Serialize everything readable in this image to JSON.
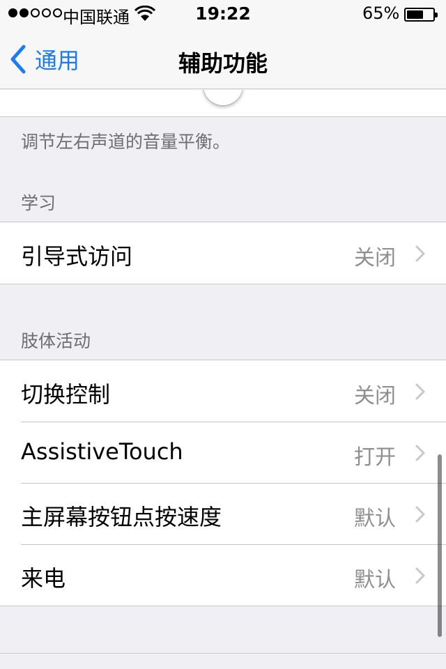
{
  "status_bar": {
    "signal_total": 5,
    "signal_active": 2,
    "carrier": "中国联通",
    "time": "19:22",
    "battery_text": "65%",
    "battery_level": 0.65
  },
  "nav": {
    "back_label": "通用",
    "title": "辅助功能"
  },
  "audio": {
    "footnote": "调节左右声道的音量平衡。"
  },
  "sections": [
    {
      "header": "学习",
      "rows": [
        {
          "label": "引导式访问",
          "value": "关闭"
        }
      ]
    },
    {
      "header": "肢体活动",
      "rows": [
        {
          "label": "切换控制",
          "value": "关闭"
        },
        {
          "label": "AssistiveTouch",
          "value": "打开"
        },
        {
          "label": "主屏幕按钮点按速度",
          "value": "默认"
        },
        {
          "label": "来电",
          "value": "默认"
        }
      ]
    }
  ],
  "colors": {
    "tint": "#1a7cf5",
    "secondary_text": "#8e8e93",
    "group_background": "#efeff4"
  },
  "icons": [
    "wifi-icon",
    "battery-icon",
    "back-chevron-icon",
    "chevron-right-icon"
  ]
}
